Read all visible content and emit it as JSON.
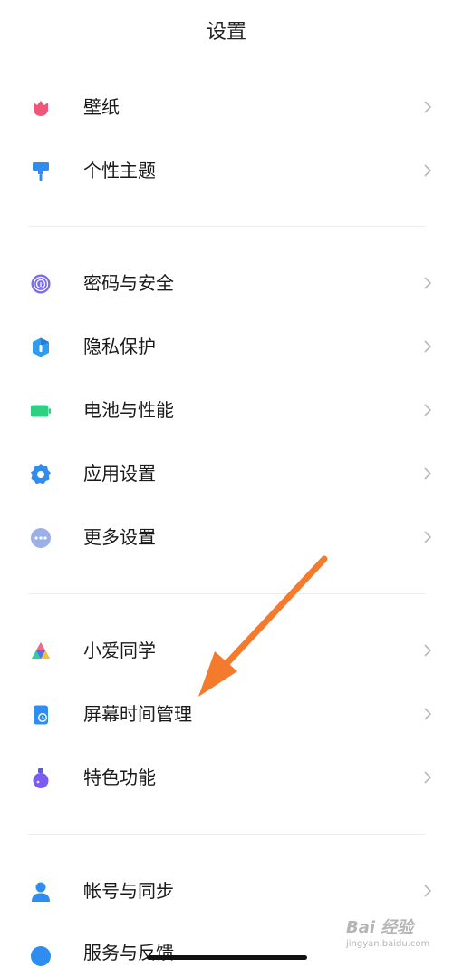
{
  "header": {
    "title": "设置"
  },
  "sections": [
    {
      "items": [
        {
          "id": "wallpaper",
          "label": "壁纸",
          "icon": "tulip-icon",
          "color": "#f0557a"
        },
        {
          "id": "theme",
          "label": "个性主题",
          "icon": "paint-roller-icon",
          "color": "#2f8cf0"
        }
      ]
    },
    {
      "items": [
        {
          "id": "security",
          "label": "密码与安全",
          "icon": "fingerprint-icon",
          "color": "#7a6cf0"
        },
        {
          "id": "privacy",
          "label": "隐私保护",
          "icon": "shield-icon",
          "color": "#2f9cf0"
        },
        {
          "id": "battery",
          "label": "电池与性能",
          "icon": "battery-icon",
          "color": "#2ed084"
        },
        {
          "id": "apps",
          "label": "应用设置",
          "icon": "gear-icon",
          "color": "#2f8cf0"
        },
        {
          "id": "more",
          "label": "更多设置",
          "icon": "more-dots-icon",
          "color": "#9ab0e6"
        }
      ]
    },
    {
      "items": [
        {
          "id": "xiaoai",
          "label": "小爱同学",
          "icon": "xiaoai-icon",
          "color": "#5b6cf0"
        },
        {
          "id": "screen-time",
          "label": "屏幕时间管理",
          "icon": "screen-time-icon",
          "color": "#2f8cf0"
        },
        {
          "id": "features",
          "label": "特色功能",
          "icon": "flask-icon",
          "color": "#7a5cf0"
        }
      ]
    },
    {
      "items": [
        {
          "id": "account",
          "label": "帐号与同步",
          "icon": "user-icon",
          "color": "#2f8cf0"
        }
      ]
    }
  ],
  "partial_item": {
    "label": "服务与反馈",
    "icon": "feedback-icon",
    "color": "#2f8cf0"
  },
  "annotation": {
    "arrow_color": "#f47a2e"
  },
  "watermark": {
    "main": "Bai 经验",
    "sub": "jingyan.baidu.com"
  }
}
